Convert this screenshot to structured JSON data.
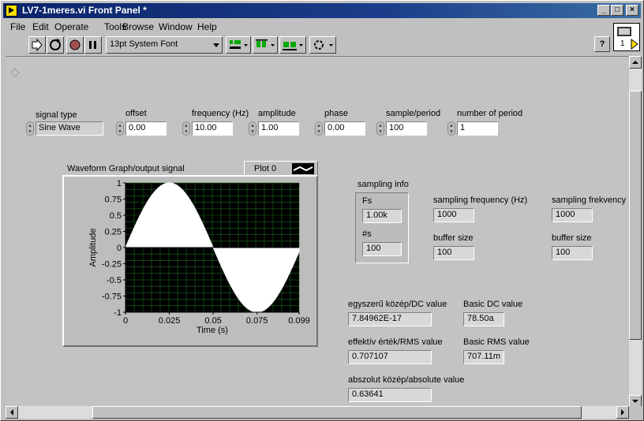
{
  "window": {
    "title": "LV7-1meres.vi Front Panel *",
    "minimize": "_",
    "maximize": "□",
    "close": "×"
  },
  "menu": [
    "File",
    "Edit",
    "Operate",
    "Tools",
    "Browse",
    "Window",
    "Help"
  ],
  "toolbar": {
    "font": "13pt System Font",
    "help": "?",
    "vi_icon_text": "1"
  },
  "controls": {
    "signal_type": {
      "label": "signal type",
      "value": "Sine Wave"
    },
    "offset": {
      "label": "offset",
      "value": "0.00"
    },
    "frequency": {
      "label": "frequency (Hz)",
      "value": "10.00"
    },
    "amplitude": {
      "label": "amplitude",
      "value": "1.00"
    },
    "phase": {
      "label": "phase",
      "value": "0.00"
    },
    "sample_period": {
      "label": "sample/period",
      "value": "100"
    },
    "number_of_period": {
      "label": "number of period",
      "value": "1"
    }
  },
  "graph": {
    "label": "Waveform Graph/output signal",
    "legend": "Plot 0",
    "ylabel": "Amplitude",
    "xlabel": "Time (s)",
    "yticks": [
      "1",
      "0.75",
      "0.5",
      "0.25",
      "0",
      "-0.25",
      "-0.5",
      "-0.75",
      "-1"
    ],
    "xticks": [
      "0",
      "0.025",
      "0.05",
      "0.075",
      "0.099"
    ],
    "background": "#000000",
    "grid_color": "#1f6b1f",
    "plot_color": "#ffffff"
  },
  "sampling_info": {
    "title": "sampling info",
    "fs_label": "Fs",
    "fs_value": "1.00k",
    "ns_label": "#s",
    "ns_value": "100"
  },
  "indicators": {
    "sampling_frequency": {
      "label": "sampling frequency  (Hz)",
      "value": "1000"
    },
    "buffer_size_1": {
      "label": "buffer size",
      "value": "100"
    },
    "sampling_frekvency": {
      "label": "sampling frekvency",
      "value": "1000"
    },
    "buffer_size_2": {
      "label": "buffer size",
      "value": "100"
    },
    "dc": {
      "label": "egyszerű közép/DC value",
      "value": "7.84962E-17"
    },
    "basic_dc": {
      "label": "Basic DC value",
      "value": "78.50a"
    },
    "rms": {
      "label": "effektív érték/RMS value",
      "value": "0.707107"
    },
    "basic_rms": {
      "label": "Basic RMS value",
      "value": "707.11m"
    },
    "abs": {
      "label": "abszolut közép/absolute value",
      "value": "0.63641"
    }
  },
  "chart_data": {
    "type": "area",
    "title": "Waveform Graph/output signal",
    "xlabel": "Time (s)",
    "ylabel": "Amplitude",
    "xlim": [
      0,
      0.099
    ],
    "ylim": [
      -1,
      1
    ],
    "grid": true,
    "series": [
      {
        "name": "Plot 0",
        "x_start": 0,
        "dx": 0.001,
        "n": 100,
        "function": "sine",
        "amplitude": 1,
        "frequency_hz": 10,
        "phase": 0,
        "offset": 0
      }
    ]
  }
}
